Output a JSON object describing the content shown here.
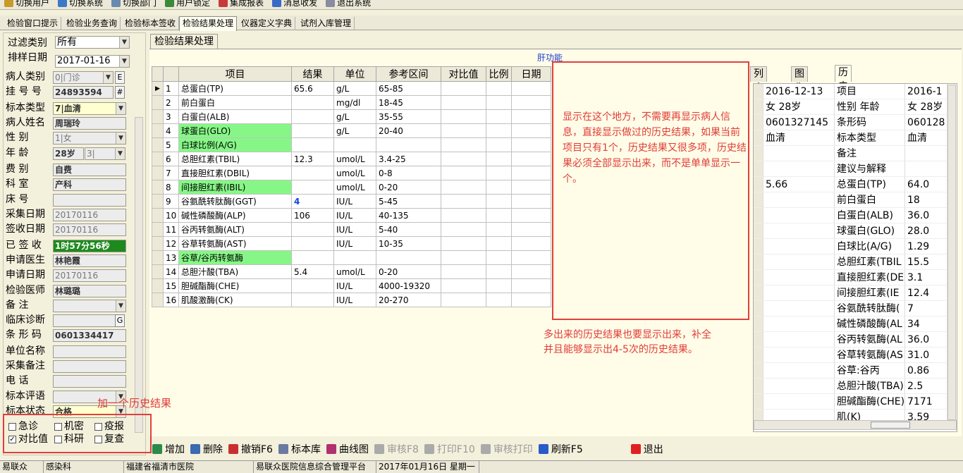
{
  "toolbar": {
    "items": [
      {
        "label": "切换用户",
        "icon": "user-switch-icon",
        "color": "#c89a2a"
      },
      {
        "label": "切换系统",
        "icon": "system-switch-icon",
        "color": "#3c7ac8"
      },
      {
        "label": "切换部门",
        "icon": "department-switch-icon",
        "color": "#6a8ab0"
      },
      {
        "label": "用户锁定",
        "icon": "lock-user-icon",
        "color": "#3a8a3a"
      },
      {
        "label": "集成报表",
        "icon": "report-icon",
        "color": "#c83a3a"
      },
      {
        "label": "消息收发",
        "icon": "message-icon",
        "color": "#3a6ac8"
      },
      {
        "label": "退出系统",
        "icon": "exit-system-icon",
        "color": "#8a8aa0"
      }
    ]
  },
  "menu": {
    "items": [
      {
        "label": "检验窗口提示"
      },
      {
        "label": "检验业务查询"
      },
      {
        "label": "检验标本签收"
      },
      {
        "label": "检验结果处理",
        "active": true
      },
      {
        "label": "仪器定义字典"
      },
      {
        "label": "试剂入库管理"
      }
    ]
  },
  "left": {
    "filter_label": "过滤类别",
    "filter_value": "所有",
    "date_label": "排样日期",
    "date_value": "2017-01-16",
    "fields": [
      {
        "label": "病人类别",
        "value": "0|门诊"
      },
      {
        "label": "挂 号 号",
        "value": "24893594"
      },
      {
        "label": "标本类型",
        "value": "7|血清"
      },
      {
        "label": "病人姓名",
        "value": "周瑞玲"
      },
      {
        "label": "性    别",
        "value": "1|女"
      },
      {
        "label": "年    龄",
        "value": "28岁",
        "value2": "3|"
      },
      {
        "label": "费    别",
        "value": "自费"
      },
      {
        "label": "科    室",
        "value": "产科"
      },
      {
        "label": "床    号",
        "value": ""
      },
      {
        "label": "采集日期",
        "value": "20170116"
      },
      {
        "label": "签收日期",
        "value": "20170116"
      },
      {
        "label": "已 签 收",
        "value": "1时57分56秒"
      },
      {
        "label": "申请医生",
        "value": "林艳霞"
      },
      {
        "label": "申请日期",
        "value": "20170116"
      },
      {
        "label": "检验医师",
        "value": "林璐璐"
      },
      {
        "label": "备    注",
        "value": ""
      },
      {
        "label": "临床诊断",
        "value": ""
      },
      {
        "label": "条 形 码",
        "value": "0601334417"
      },
      {
        "label": "单位名称",
        "value": ""
      },
      {
        "label": "采集备注",
        "value": ""
      },
      {
        "label": "电    话",
        "value": ""
      },
      {
        "label": "标本评语",
        "value": ""
      },
      {
        "label": "标本状态",
        "value": "合格"
      }
    ],
    "btn_e": "E",
    "btn_hash": "#",
    "btn_g": "G",
    "checks": [
      {
        "label": "急诊",
        "checked": false
      },
      {
        "label": "机密",
        "checked": false
      },
      {
        "label": "疫报",
        "checked": false
      },
      {
        "label": "对比值",
        "checked": true
      },
      {
        "label": "科研",
        "checked": false
      },
      {
        "label": "复查",
        "checked": false
      }
    ]
  },
  "main": {
    "tab": "检验结果处理",
    "group_label": "肝功能",
    "columns": [
      "项目",
      "结果",
      "单位",
      "参考区间",
      "对比值",
      "比例",
      "日期"
    ],
    "rows": [
      {
        "no": "1",
        "item": "总蛋白(TP)",
        "result": "65.6",
        "unit": "g/L",
        "range": "65-85"
      },
      {
        "no": "2",
        "item": "前白蛋白",
        "result": "",
        "unit": "mg/dl",
        "range": "18-45"
      },
      {
        "no": "3",
        "item": "白蛋白(ALB)",
        "result": "",
        "unit": "g/L",
        "range": "35-55"
      },
      {
        "no": "4",
        "item": "球蛋白(GLO)",
        "result": "",
        "unit": "g/L",
        "range": "20-40",
        "green": true
      },
      {
        "no": "5",
        "item": "白球比例(A/G)",
        "result": "",
        "unit": "",
        "range": "",
        "green": true
      },
      {
        "no": "6",
        "item": "总胆红素(TBIL)",
        "result": "12.3",
        "unit": "umol/L",
        "range": "3.4-25"
      },
      {
        "no": "7",
        "item": "直接胆红素(DBIL)",
        "result": "",
        "unit": "umol/L",
        "range": "0-8"
      },
      {
        "no": "8",
        "item": "间接胆红素(IBIL)",
        "result": "",
        "unit": "umol/L",
        "range": "0-20",
        "green": true
      },
      {
        "no": "9",
        "item": "谷氨酰转肽酶(GGT)",
        "result": "4",
        "unit": "IU/L",
        "range": "5-45",
        "blue": true
      },
      {
        "no": "10",
        "item": "碱性磷酸酶(ALP)",
        "result": "106",
        "unit": "IU/L",
        "range": "40-135"
      },
      {
        "no": "11",
        "item": "谷丙转氨酶(ALT)",
        "result": "",
        "unit": "IU/L",
        "range": "5-40"
      },
      {
        "no": "12",
        "item": "谷草转氨酶(AST)",
        "result": "",
        "unit": "IU/L",
        "range": "10-35"
      },
      {
        "no": "13",
        "item": "谷草/谷丙转氨酶",
        "result": "",
        "unit": "",
        "range": "",
        "green": true
      },
      {
        "no": "14",
        "item": "总胆汁酸(TBA)",
        "result": "5.4",
        "unit": "umol/L",
        "range": "0-20"
      },
      {
        "no": "15",
        "item": "胆碱酯酶(CHE)",
        "result": "",
        "unit": "IU/L",
        "range": "4000-19320"
      },
      {
        "no": "16",
        "item": "肌酸激酶(CK)",
        "result": "",
        "unit": "IU/L",
        "range": "20-270"
      }
    ]
  },
  "right": {
    "tabs": [
      {
        "label": "列表"
      },
      {
        "label": "图像"
      },
      {
        "label": "历史结果",
        "active": true
      }
    ],
    "history": [
      [
        "2016-12-13",
        "项目",
        "2016-1"
      ],
      [
        "女 28岁",
        "性别 年龄",
        "女 28岁"
      ],
      [
        "0601327145",
        "条形码",
        "060128"
      ],
      [
        "血清",
        "标本类型",
        "血清"
      ],
      [
        "",
        "备注",
        ""
      ],
      [
        "",
        "建议与解释",
        ""
      ],
      [
        "5.66",
        "总蛋白(TP)",
        "64.0"
      ],
      [
        "",
        "前白蛋白",
        "18"
      ],
      [
        "",
        "白蛋白(ALB)",
        "36.0"
      ],
      [
        "",
        "球蛋白(GLO)",
        "28.0"
      ],
      [
        "",
        "白球比(A/G)",
        "1.29"
      ],
      [
        "",
        "总胆红素(TBIL",
        "15.5"
      ],
      [
        "",
        "直接胆红素(DE",
        "3.1"
      ],
      [
        "",
        "间接胆红素(IE",
        "12.4"
      ],
      [
        "",
        "谷氨酰转肽酶(",
        "7"
      ],
      [
        "",
        "碱性磷酸酶(AL",
        "34"
      ],
      [
        "",
        "谷丙转氨酶(AL",
        "36.0"
      ],
      [
        "",
        "谷草转氨酶(AS",
        "31.0"
      ],
      [
        "",
        "谷草:谷丙",
        "0.86"
      ],
      [
        "",
        "总胆汁酸(TBA)",
        "2.5"
      ],
      [
        "",
        "胆碱酯酶(CHE)",
        "7171"
      ],
      [
        "",
        "肌(K)",
        "3.59"
      ]
    ]
  },
  "bottom": {
    "buttons": [
      {
        "label": "增加",
        "icon": "add-icon",
        "color": "#2a8a4a",
        "disabled": false
      },
      {
        "label": "删除",
        "icon": "delete-icon",
        "color": "#3a6ab0",
        "disabled": false
      },
      {
        "label": "撤销F6",
        "icon": "undo-icon",
        "color": "#c83030",
        "disabled": false
      },
      {
        "label": "标本库",
        "icon": "specimen-library-icon",
        "color": "#6a7aa0",
        "disabled": false
      },
      {
        "label": "曲线图",
        "icon": "curve-chart-icon",
        "color": "#b03070",
        "disabled": false
      },
      {
        "label": "审核F8",
        "icon": "audit-icon",
        "color": "#aaaaaa",
        "disabled": true
      },
      {
        "label": "打印F10",
        "icon": "print-icon",
        "color": "#aaaaaa",
        "disabled": true
      },
      {
        "label": "审核打印",
        "icon": "audit-print-icon",
        "color": "#aaaaaa",
        "disabled": true
      },
      {
        "label": "刷新F5",
        "icon": "refresh-icon",
        "color": "#2a5ac8",
        "disabled": false
      },
      {
        "label": "退出",
        "icon": "exit-icon",
        "color": "#e02020",
        "disabled": false
      }
    ]
  },
  "status": [
    "易联众",
    "感染科",
    "福建省福清市医院",
    "易联众医院信息综合管理平台",
    "2017年01月16日 星期一"
  ],
  "annotations": {
    "box1": "显示在这个地方，不需要再显示病人信息，直接显示做过的历史结果，如果当前项目只有1个，历史结果又很多项，历史结果必须全部显示出来，而不是单单显示一个。",
    "note2_line1": "多出来的历史结果也要显示出来，补全",
    "note2_line2": "并且能够显示出4-5次的历史结果。",
    "note3": "加一个历史结果"
  },
  "colors": {
    "annotation_red": "#e03c36",
    "highlight_green": "#86f786",
    "signed_green": "#1e8a1e"
  }
}
